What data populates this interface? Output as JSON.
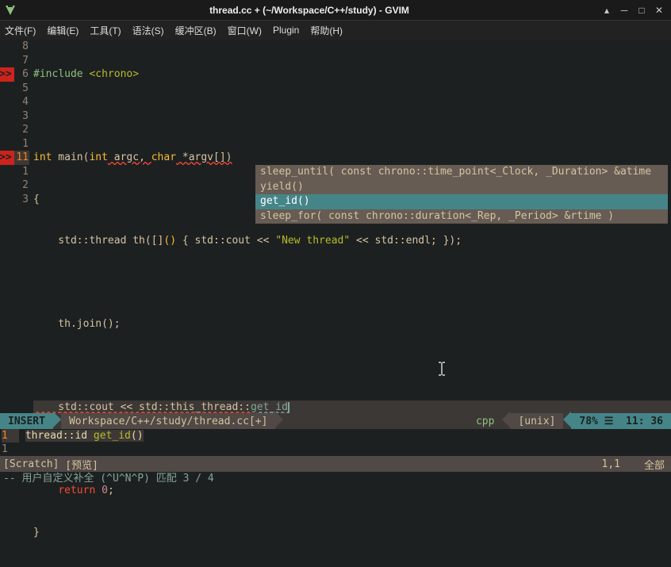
{
  "window": {
    "title": "thread.cc + (~/Workspace/C++/study) - GVIM"
  },
  "menu": {
    "file": "文件(F)",
    "edit": "编辑(E)",
    "tools": "工具(T)",
    "syntax": "语法(S)",
    "buffers": "缓冲区(B)",
    "window": "窗口(W)",
    "plugin": "Plugin",
    "help": "帮助(H)"
  },
  "gutter": {
    "nums": [
      "8",
      "7",
      "6",
      "5",
      "4",
      "3",
      "2",
      "1",
      "11",
      "1",
      "2",
      "3"
    ],
    "sign6": ">>",
    "sign11": ">>"
  },
  "code": {
    "l1_a": "#include",
    "l1_b": " <chrono>",
    "l3_a": "int",
    "l3_b": " main(",
    "l3_c": "int",
    "l3_d": " argc, ",
    "l3_e": "char",
    "l3_f": " *argv[])",
    "l4": "{",
    "l5_a": "    std::thread th([]",
    "l5_b": "()",
    "l5_c": " { std::cout << ",
    "l5_d": "\"New thread\"",
    "l5_e": " << std::endl; });",
    "l7": "    th.join();",
    "l9_a": "    std::cout << std::this_thread::",
    "l9_b": "get_id",
    "l11_a": "    ",
    "l11_b": "return",
    "l11_c": " ",
    "l11_d": "0",
    "l11_e": ";",
    "l12": "}"
  },
  "completion": {
    "items": [
      "sleep_until( const chrono::time_point<_Clock, _Duration> &atime",
      "yield()",
      "get_id()",
      "sleep_for( const chrono::duration<_Rep, _Period> &rtime )"
    ],
    "selected_index": 2
  },
  "statusline": {
    "mode": "INSERT",
    "filepath": "Workspace/C++/study/thread.cc",
    "modified": "[+]",
    "filetype": "cpp",
    "fileformat": "[unix]",
    "percent": "78%",
    "sep_icon": "☰",
    "line": "11",
    "col": "36",
    "colsep": ":"
  },
  "preview": {
    "gutter1": "1",
    "line1_a": "thread::id ",
    "line1_b": "get_id",
    "line1_c": "()",
    "gutter2": "1",
    "status_name": "[Scratch]",
    "status_tag": "[预览]",
    "pos": "1,1",
    "scroll": "全部"
  },
  "cmdline": "-- 用户自定义补全 (^U^N^P) 匹配 3 / 4",
  "icons": {
    "vim": "vim-icon",
    "window_up": "window-up-icon",
    "window_min": "window-minimize-icon",
    "window_max": "window-maximize-icon",
    "window_close": "window-close-icon",
    "text_cursor": "text-cursor-icon"
  }
}
